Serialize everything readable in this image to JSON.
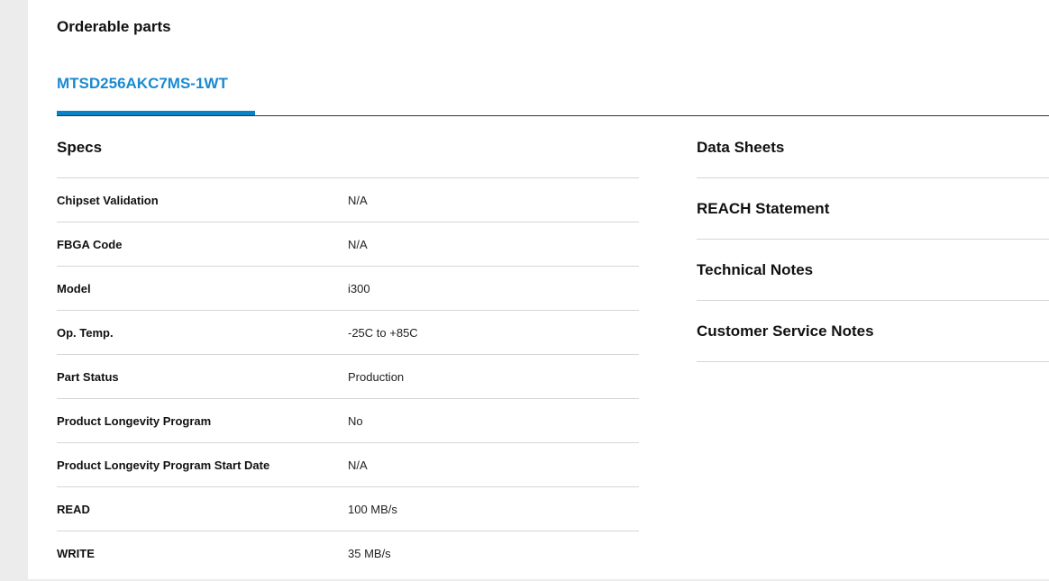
{
  "page_title": "Orderable parts",
  "tab": {
    "part_number": "MTSD256AKC7MS-1WT"
  },
  "specs": {
    "title": "Specs",
    "rows": [
      {
        "label": "Chipset Validation",
        "value": "N/A"
      },
      {
        "label": "FBGA Code",
        "value": "N/A"
      },
      {
        "label": "Model",
        "value": "i300"
      },
      {
        "label": "Op. Temp.",
        "value": "-25C to +85C"
      },
      {
        "label": "Part Status",
        "value": "Production"
      },
      {
        "label": "Product Longevity Program",
        "value": "No"
      },
      {
        "label": "Product Longevity Program Start Date",
        "value": "N/A"
      },
      {
        "label": "READ",
        "value": "100 MB/s"
      },
      {
        "label": "WRITE",
        "value": "35 MB/s"
      }
    ]
  },
  "documents": [
    {
      "label": "Data Sheets"
    },
    {
      "label": "REACH Statement"
    },
    {
      "label": "Technical Notes"
    },
    {
      "label": "Customer Service Notes"
    }
  ],
  "colors": {
    "accent": "#0a82c7",
    "tab_text": "#1a8ad1",
    "sidebar_bg": "#ececec"
  }
}
